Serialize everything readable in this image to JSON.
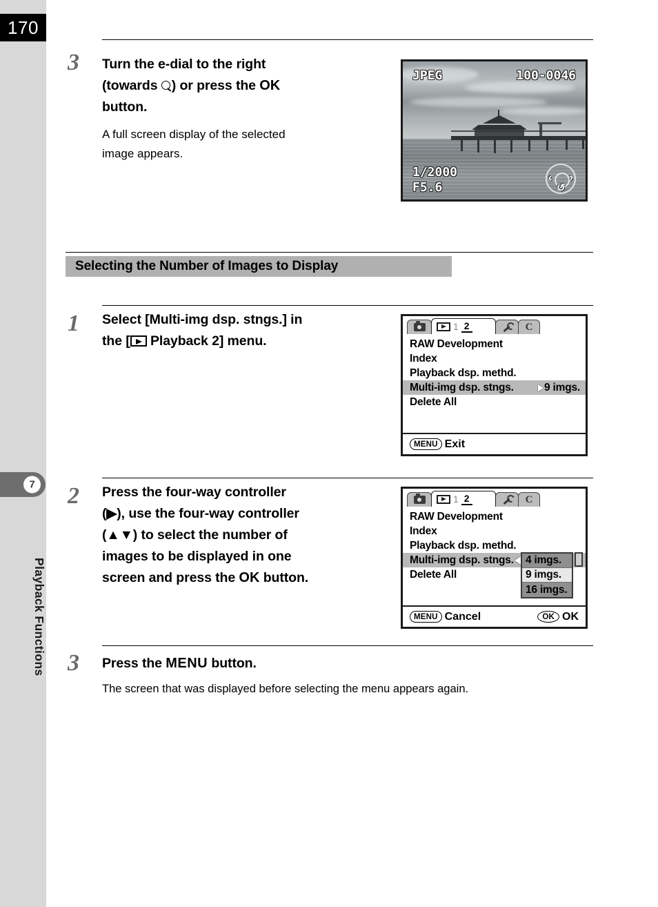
{
  "page": {
    "number": "170"
  },
  "sidebar": {
    "chapter_number": "7",
    "chapter_label": "Playback Functions"
  },
  "steps": [
    {
      "number": "3",
      "heading_line1": "Turn the e-dial to the right",
      "heading_line2_pre": "(towards ",
      "heading_line2_icon": "magnifier-icon",
      "heading_line2_mid": ") or press the ",
      "heading_line2_ok": "OK",
      "heading_line3": "button.",
      "body_line1": "A full screen display of the selected",
      "body_line2": "image appears."
    },
    {
      "number": "1",
      "heading_line1": "Select [Multi-img dsp. stngs.] in",
      "heading_line2_pre": "the [",
      "heading_line2_icon": "playback-icon",
      "heading_line2_post": " Playback 2] menu."
    },
    {
      "number": "2",
      "heading_line1": "Press the four-way controller",
      "heading_line2": "(▶), use the four-way controller",
      "heading_line3": "(▲▼) to select the number of",
      "heading_line4": "images to be displayed in one",
      "heading_line5_pre": "screen and press the ",
      "heading_line5_ok": "OK",
      "heading_line5_post": " button."
    },
    {
      "number": "3",
      "heading_pre": "Press the ",
      "heading_menu": "MENU",
      "heading_post": " button.",
      "body_line1": "The screen that was displayed before selecting the menu appears again."
    }
  ],
  "section": {
    "title": "Selecting the Number of Images to Display"
  },
  "lcd_photo": {
    "format_label": "JPEG",
    "file_number": "100-0046",
    "shutter_speed": "1/2000",
    "aperture": "F5.6",
    "left_arrow": "‹",
    "right_arrow": "›",
    "rotate_glyph": "↺"
  },
  "menu_screen_1": {
    "tabs": {
      "camera_icon": "camera-icon",
      "playback_icon": "playback-icon",
      "page_1": "1",
      "page_2": "2",
      "wrench_icon": "wrench-icon",
      "custom_label": "C"
    },
    "items": [
      {
        "label": "RAW Development",
        "value": "",
        "highlight": false
      },
      {
        "label": "Index",
        "value": "",
        "highlight": false
      },
      {
        "label": "Playback dsp. methd.",
        "value": "",
        "highlight": false
      },
      {
        "label": "Multi-img dsp. stngs.",
        "value": "9 imgs.",
        "highlight": true
      },
      {
        "label": "Delete All",
        "value": "",
        "highlight": false
      }
    ],
    "footer": {
      "menu_pill": "MENU",
      "menu_label": "Exit"
    }
  },
  "menu_screen_2": {
    "tabs": {
      "camera_icon": "camera-icon",
      "playback_icon": "playback-icon",
      "page_1": "1",
      "page_2": "2",
      "wrench_icon": "wrench-icon",
      "custom_label": "C"
    },
    "items": [
      {
        "label": "RAW Development",
        "highlight": false
      },
      {
        "label": "Index",
        "highlight": false
      },
      {
        "label": "Playback dsp. methd.",
        "highlight": false
      },
      {
        "label": "Multi-img dsp. stngs.",
        "highlight": true
      },
      {
        "label": "Delete All",
        "highlight": false
      }
    ],
    "dropdown": {
      "options": [
        {
          "label": "4 imgs.",
          "state": "dim"
        },
        {
          "label": "9 imgs.",
          "state": "selected"
        },
        {
          "label": "16 imgs.",
          "state": "dim"
        }
      ]
    },
    "footer": {
      "menu_pill": "MENU",
      "menu_label": "Cancel",
      "ok_pill": "OK",
      "ok_label": "OK"
    }
  },
  "colors": {
    "sidebar_bg": "#d8d8d8",
    "pagenum_bg": "#000000",
    "chapter_tab_bg": "#6e6e6e",
    "section_band_bg": "#b0b0b0",
    "menu_highlight": "#b9b9b9",
    "step_number": "#6a6a6a"
  }
}
